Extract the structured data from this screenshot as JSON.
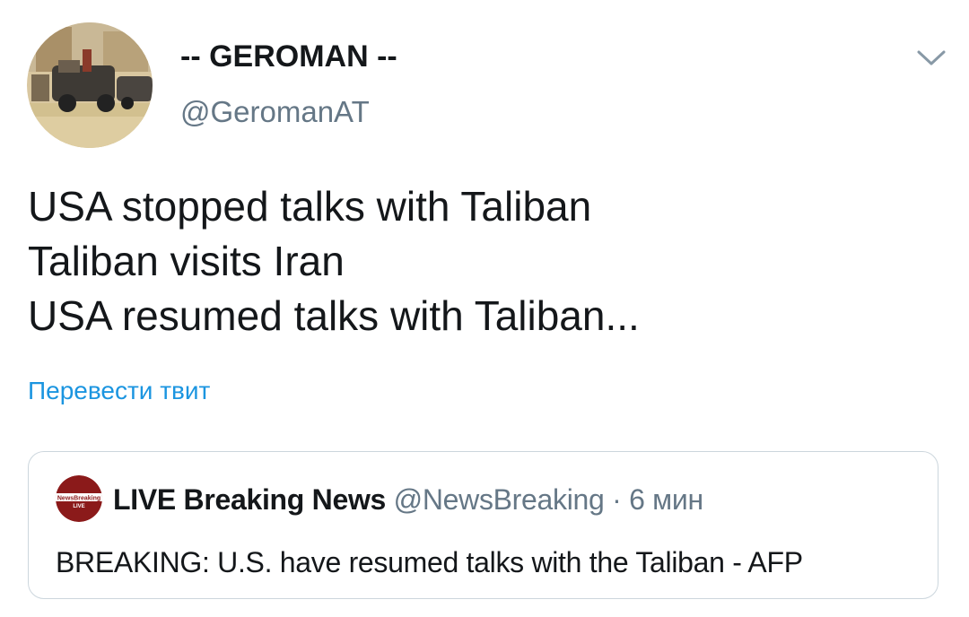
{
  "tweet": {
    "author": {
      "display_name": "-- GEROMAN --",
      "handle": "@GeromanAT",
      "avatar_icon": "avatar-photo-street-cars"
    },
    "menu_icon": "chevron-down-icon",
    "text_lines": [
      "USA stopped talks with Taliban",
      "Taliban visits Iran",
      "USA resumed talks with Taliban..."
    ],
    "translate_label": "Перевести твит"
  },
  "quoted_tweet": {
    "display_name": "LIVE Breaking News",
    "handle": "@NewsBreaking",
    "separator": "·",
    "time": "6 мин",
    "avatar_icon": "news-breaking-live-logo",
    "avatar_text": "NewsBreaking",
    "avatar_sub_text": "LIVE",
    "text": "BREAKING: U.S. have resumed talks with the Taliban - AFP"
  },
  "colors": {
    "text_primary": "#14171a",
    "text_secondary": "#657786",
    "link": "#1b95e0",
    "border": "#ccd6dd",
    "logo_red": "#8b1a1a"
  }
}
